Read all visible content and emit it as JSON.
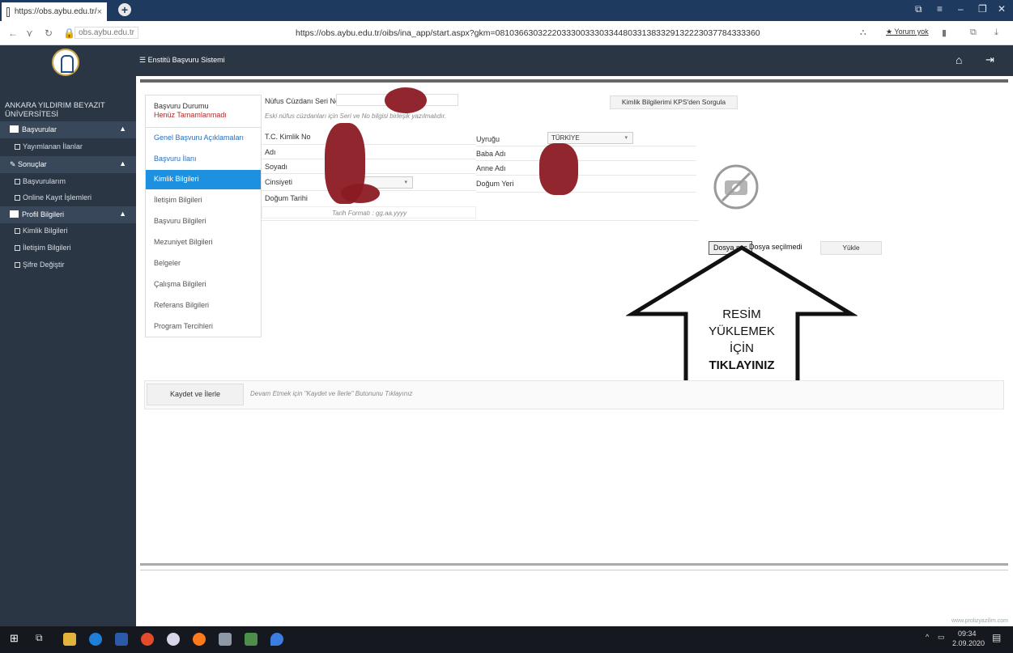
{
  "browser": {
    "tab_title": "https://obs.aybu.edu.tr/",
    "tab_close": "×",
    "new_tab": "+",
    "url_short": "obs.aybu.edu.tr",
    "url_full": "https://obs.aybu.edu.tr/oibs/ina_app/start.aspx?gkm=08103663032220333003330334480331383329132223037784333360",
    "rating": "★ Yorum yok"
  },
  "app": {
    "university": "ANKARA YILDIRIM BEYAZIT ÜNİVERSİTESİ",
    "system_title": "Enstitü Başvuru Sistemi"
  },
  "sidebar": {
    "sections": [
      {
        "label": "Başvurular",
        "items": [
          "Yayımlanan İlanlar"
        ]
      },
      {
        "label": "Sonuçlar",
        "items": [
          "Başvurularım",
          "Online Kayıt İşlemleri"
        ]
      },
      {
        "label": "Profil Bilgileri",
        "items": [
          "Kimlik Bilgileri",
          "İletişim Bilgileri",
          "Şifre Değiştir"
        ]
      }
    ]
  },
  "submenu": {
    "status_title": "Başvuru Durumu",
    "status_value": "Henüz Tamamlanmadı",
    "items": [
      "Genel Başvuru Açıklamaları",
      "Başvuru İlanı",
      "Kimlik Bilgileri",
      "İletişim Bilgileri",
      "Başvuru Bilgileri",
      "Mezuniyet Bilgileri",
      "Belgeler",
      "Çalışma Bilgileri",
      "Referans Bilgileri",
      "Program Tercihleri"
    ]
  },
  "form": {
    "serial_label": "Nüfus Cüzdanı Seri No",
    "serial_hint": "Eski nüfus cüzdanları için Seri ve No bilgisi birleşik yazılmalıdır.",
    "kps_button": "Kimlik Bilgilerimi KPS'den Sorgula",
    "tc_label": "T.C. Kimlik No",
    "name_label": "Adı",
    "surname_label": "Soyadı",
    "gender_label": "Cinsiyeti",
    "birthdate_label": "Doğum Tarihi",
    "date_hint": "Tarih Formatı : gg.aa.yyyy",
    "nationality_label": "Uyruğu",
    "nationality_value": "TÜRKİYE",
    "father_label": "Baba Adı",
    "mother_label": "Anne Adı",
    "birthplace_label": "Doğum Yeri",
    "choose_file": "Dosya seç",
    "no_file": "Dosya seçilmedi",
    "upload": "Yükle"
  },
  "save": {
    "button": "Kaydet ve İlerle",
    "hint": "Devam Etmek için \"Kaydet ve İlerle\" Butonunu Tıklayınız"
  },
  "annotation": {
    "line1": "RESİM YÜKLEMEK",
    "line2": "İÇİN",
    "line3": "TIKLAYINIZ"
  },
  "footer": {
    "credit": "www.prolizyazilim.com"
  },
  "taskbar": {
    "time": "09:34",
    "date": "2.09.2020"
  },
  "colors": {
    "sidebar": "#2b3645",
    "active": "#1e90e0",
    "status": "#b02a2a",
    "redaction": "#8b1a23"
  }
}
